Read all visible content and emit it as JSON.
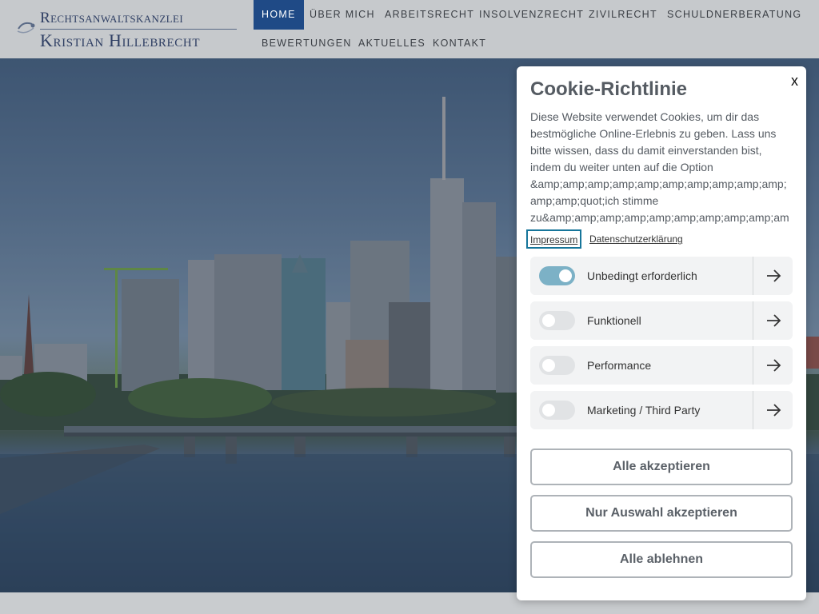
{
  "logo": {
    "line1": "Rechtsanwaltskanzlei",
    "line2": "Kristian Hillebrecht"
  },
  "nav": {
    "items": [
      {
        "label": "HOME",
        "active": true
      },
      {
        "label": "ÜBER MICH",
        "active": false
      },
      {
        "label": "ARBEITSRECHT",
        "active": false
      },
      {
        "label": "INSOLVENZRECHT",
        "active": false
      },
      {
        "label": "ZIVILRECHT",
        "active": false
      },
      {
        "label": "SCHULDNERBERATUNG",
        "active": false
      },
      {
        "label": "BEWERTUNGEN",
        "active": false
      },
      {
        "label": "AKTUELLES",
        "active": false
      },
      {
        "label": "KONTAKT",
        "active": false
      }
    ]
  },
  "cookie": {
    "close_label": "x",
    "title": "Cookie-Richtlinie",
    "text": "Diese Website verwendet Cookies, um dir das bestmögliche Online-Erlebnis zu geben. Lass uns bitte wissen, dass du damit einverstanden bist, indem du weiter unten auf die Option &amp;amp;amp;amp;amp;amp;amp;amp;amp;amp;amp;amp;quot;ich stimme zu&amp;amp;amp;amp;amp;amp;amp;amp;amp;amp;amp;amp;quot; klickst.",
    "links": {
      "impressum": "Impressum",
      "datenschutz": "Datenschutzerklärung"
    },
    "categories": [
      {
        "label": "Unbedingt erforderlich",
        "enabled": true
      },
      {
        "label": "Funktionell",
        "enabled": false
      },
      {
        "label": "Performance",
        "enabled": false
      },
      {
        "label": "Marketing / Third Party",
        "enabled": false
      }
    ],
    "buttons": {
      "accept_all": "Alle akzeptieren",
      "accept_selection": "Nur Auswahl akzeptieren",
      "reject_all": "Alle ablehnen"
    }
  },
  "colors": {
    "nav_active_bg": "#1f4a86",
    "toggle_on": "#7cb1c6",
    "toggle_off": "#e1e3e5",
    "focus_outline": "#16759a"
  }
}
